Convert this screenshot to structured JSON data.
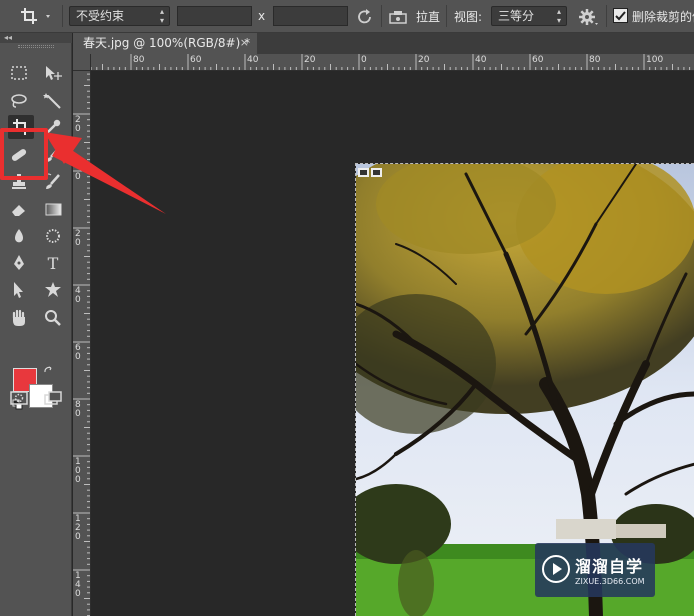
{
  "options_bar": {
    "tool_icon": "crop-icon",
    "ratio_select": "不受约束",
    "width_value": "",
    "height_value": "",
    "swap_symbol": "x",
    "swap_icon": "rotate-icon",
    "straighten_icon": "level-icon",
    "straighten_label": "拉直",
    "view_label": "视图:",
    "view_select": "三等分",
    "settings_icon": "gear-icon",
    "delete_cropped_checked": true,
    "delete_cropped_label": "删除裁剪的像"
  },
  "toolbar": {
    "collapse_glyph": "◂◂",
    "tools": [
      {
        "name": "marquee-tool-icon"
      },
      {
        "name": "move-tool-icon"
      },
      {
        "name": "lasso-tool-icon"
      },
      {
        "name": "magic-wand-icon"
      },
      {
        "name": "crop-tool-icon",
        "active": true
      },
      {
        "name": "eyedropper-icon"
      },
      {
        "name": "healing-brush-icon"
      },
      {
        "name": "brush-icon"
      },
      {
        "name": "clone-stamp-icon"
      },
      {
        "name": "history-brush-icon"
      },
      {
        "name": "eraser-icon"
      },
      {
        "name": "gradient-icon"
      },
      {
        "name": "blur-icon"
      },
      {
        "name": "dodge-icon"
      },
      {
        "name": "pen-icon"
      },
      {
        "name": "type-icon",
        "glyph": "T"
      },
      {
        "name": "path-select-icon"
      },
      {
        "name": "shape-icon"
      },
      {
        "name": "hand-icon"
      },
      {
        "name": "zoom-icon"
      },
      {
        "name": "quick-mask-icon"
      },
      {
        "name": "screen-mode-icon"
      }
    ],
    "foreground_color": "#e8383d",
    "background_color": "#ffffff",
    "highlight_color": "#ea2f2f"
  },
  "document": {
    "tab_title": "春天.jpg @ 100%(RGB/8#) *",
    "tab_close": "×"
  },
  "rulers": {
    "top_labels": [
      "80",
      "60",
      "40",
      "20",
      "0",
      "20",
      "40",
      "60",
      "80",
      "100"
    ],
    "left_labels": [
      "2 0",
      "0",
      "2 0",
      "4 0",
      "6 0",
      "8 0",
      "1 0 0",
      "1 2 0",
      "1 4 0"
    ]
  },
  "watermark": {
    "title": "溜溜自学",
    "subtitle": "ZIXUE.3D66.COM",
    "icon": "play-logo-icon"
  }
}
